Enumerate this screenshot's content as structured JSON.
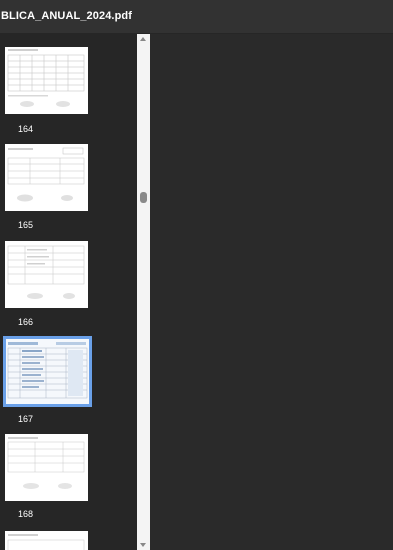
{
  "window": {
    "title": "BLICA_ANUAL_2024.pdf"
  },
  "thumbnails": [
    {
      "page": "164",
      "selected": false
    },
    {
      "page": "165",
      "selected": false
    },
    {
      "page": "166",
      "selected": false
    },
    {
      "page": "167",
      "selected": true
    },
    {
      "page": "168",
      "selected": false
    }
  ],
  "colors": {
    "selection": "#6aa0e8",
    "sidebar_bg": "#262626",
    "viewer_bg": "#2a2a2a"
  }
}
